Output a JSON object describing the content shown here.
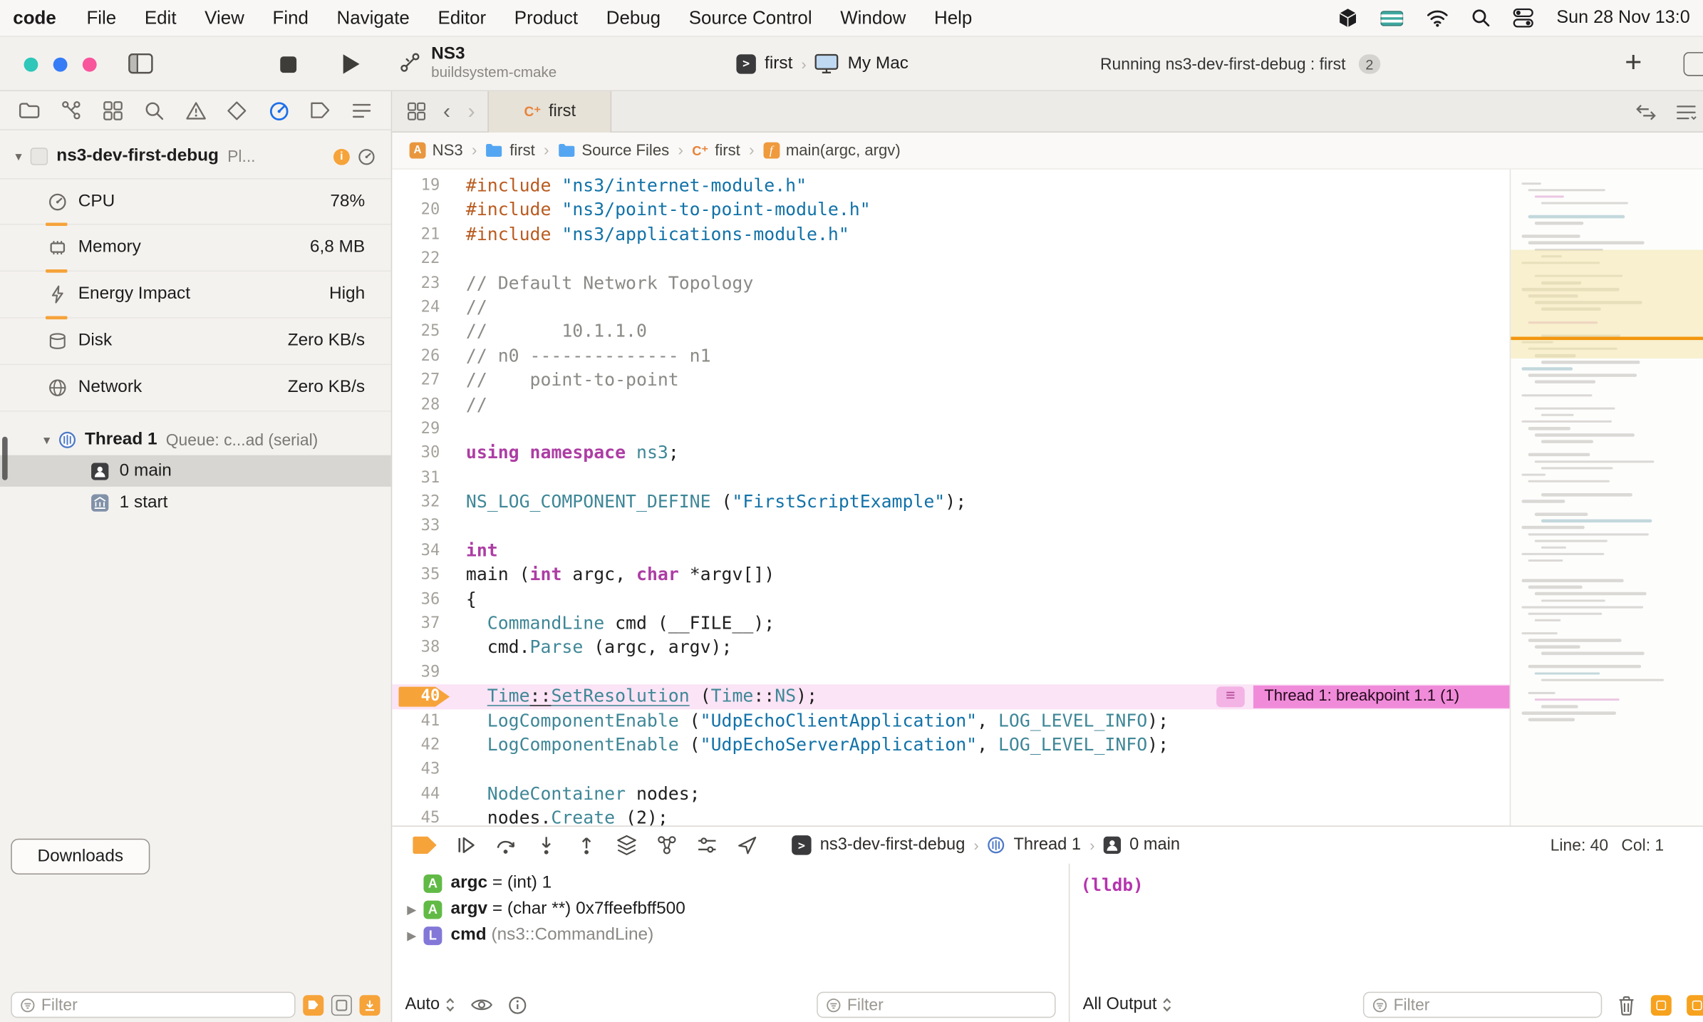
{
  "colors": {
    "accent_orange": "#F6A33A",
    "breakpoint_row_pink": "#FAE4F5",
    "breakpoint_band_pink": "#F08BD9",
    "selected_navigator_blue": "#1D6FE8",
    "traffic_light_1": "#2EC7B9",
    "traffic_light_2": "#357CF6",
    "traffic_light_3": "#F8559D",
    "auto_variable_badge": "#62BA46",
    "local_variable_badge": "#8378D8",
    "lldb_prompt": "#B535AE",
    "syntax_preprocessor": "#BA5B20",
    "syntax_string": "#1272A8",
    "syntax_keyword": "#AD3DA4",
    "syntax_type": "#3F8797",
    "syntax_comment": "#8A8A86"
  },
  "menubar": {
    "app_name": "code",
    "items": [
      "File",
      "Edit",
      "View",
      "Find",
      "Navigate",
      "Editor",
      "Product",
      "Debug",
      "Source Control",
      "Window",
      "Help"
    ],
    "clock": "Sun 28 Nov 13:0"
  },
  "toolbar": {
    "scheme_name": "NS3",
    "scheme_subtitle": "buildsystem-cmake",
    "destination_scheme": "first",
    "destination_device": "My Mac",
    "status_text": "Running ns3-dev-first-debug : first",
    "status_badge": "2"
  },
  "sidebar": {
    "process_name": "ns3-dev-first-debug",
    "process_suffix": "Pl...",
    "stats": [
      {
        "label": "CPU",
        "value": "78%",
        "icon": "cpu-gauge-icon",
        "gauge": true
      },
      {
        "label": "Memory",
        "value": "6,8 MB",
        "icon": "memory-icon",
        "gauge": true
      },
      {
        "label": "Energy Impact",
        "value": "High",
        "icon": "energy-icon",
        "gauge": true
      },
      {
        "label": "Disk",
        "value": "Zero KB/s",
        "icon": "disk-icon",
        "gauge": false
      },
      {
        "label": "Network",
        "value": "Zero KB/s",
        "icon": "network-icon",
        "gauge": false
      }
    ],
    "thread_name": "Thread 1",
    "thread_detail": "Queue: c...ad (serial)",
    "frames": [
      {
        "label": "0 main",
        "icon": "person-icon",
        "selected": true
      },
      {
        "label": "1 start",
        "icon": "library-icon",
        "selected": false
      }
    ],
    "downloads_label": "Downloads",
    "filter_placeholder": "Filter"
  },
  "tabbar": {
    "active_tab": "first",
    "file_badge": "C⁺"
  },
  "breadcrumbs": [
    {
      "label": "NS3",
      "icon": "project-icon"
    },
    {
      "label": "first",
      "icon": "folder-icon"
    },
    {
      "label": "Source Files",
      "icon": "folder-icon"
    },
    {
      "label": "first",
      "icon": "cpp-file-icon"
    },
    {
      "label": "main(argc, argv)",
      "icon": "function-icon"
    }
  ],
  "editor": {
    "breakpoint_line": 40,
    "breakpoint_band_label": "Thread 1: breakpoint 1.1 (1)",
    "lines": [
      {
        "n": 19,
        "t": [
          [
            "pp",
            "#include"
          ],
          [
            "pl",
            " "
          ],
          [
            "str",
            "\"ns3/internet-module.h\""
          ]
        ]
      },
      {
        "n": 20,
        "t": [
          [
            "pp",
            "#include"
          ],
          [
            "pl",
            " "
          ],
          [
            "str",
            "\"ns3/point-to-point-module.h\""
          ]
        ]
      },
      {
        "n": 21,
        "t": [
          [
            "pp",
            "#include"
          ],
          [
            "pl",
            " "
          ],
          [
            "str",
            "\"ns3/applications-module.h\""
          ]
        ]
      },
      {
        "n": 22,
        "t": []
      },
      {
        "n": 23,
        "t": [
          [
            "com",
            "// Default Network Topology"
          ]
        ]
      },
      {
        "n": 24,
        "t": [
          [
            "com",
            "//"
          ]
        ]
      },
      {
        "n": 25,
        "t": [
          [
            "com",
            "//       10.1.1.0"
          ]
        ]
      },
      {
        "n": 26,
        "t": [
          [
            "com",
            "// n0 -------------- n1"
          ]
        ]
      },
      {
        "n": 27,
        "t": [
          [
            "com",
            "//    point-to-point"
          ]
        ]
      },
      {
        "n": 28,
        "t": [
          [
            "com",
            "//"
          ]
        ]
      },
      {
        "n": 29,
        "t": []
      },
      {
        "n": 30,
        "t": [
          [
            "kw",
            "using"
          ],
          [
            "pl",
            " "
          ],
          [
            "kw",
            "namespace"
          ],
          [
            "pl",
            " "
          ],
          [
            "ty",
            "ns3"
          ],
          [
            "pl",
            ";"
          ]
        ]
      },
      {
        "n": 31,
        "t": []
      },
      {
        "n": 32,
        "t": [
          [
            "ty",
            "NS_LOG_COMPONENT_DEFINE"
          ],
          [
            "pl",
            " ("
          ],
          [
            "str",
            "\"FirstScriptExample\""
          ],
          [
            "pl",
            ");"
          ]
        ]
      },
      {
        "n": 33,
        "t": []
      },
      {
        "n": 34,
        "t": [
          [
            "kw",
            "int"
          ]
        ]
      },
      {
        "n": 35,
        "t": [
          [
            "pl",
            "main ("
          ],
          [
            "kw",
            "int"
          ],
          [
            "pl",
            " argc, "
          ],
          [
            "kw",
            "char"
          ],
          [
            "pl",
            " *argv[])"
          ]
        ]
      },
      {
        "n": 36,
        "t": [
          [
            "pl",
            "{"
          ]
        ]
      },
      {
        "n": 37,
        "t": [
          [
            "pl",
            "  "
          ],
          [
            "ty",
            "CommandLine"
          ],
          [
            "pl",
            " cmd (__FILE__);"
          ]
        ]
      },
      {
        "n": 38,
        "t": [
          [
            "pl",
            "  cmd."
          ],
          [
            "ty",
            "Parse"
          ],
          [
            "pl",
            " (argc, argv);"
          ]
        ]
      },
      {
        "n": 39,
        "t": []
      },
      {
        "n": 40,
        "t": [
          [
            "pl",
            "  "
          ],
          [
            "ty u",
            "Time"
          ],
          [
            "pl u",
            "::"
          ],
          [
            "ty u",
            "SetResolution"
          ],
          [
            "pl",
            " ("
          ],
          [
            "ty",
            "Time"
          ],
          [
            "pl",
            "::"
          ],
          [
            "ty",
            "NS"
          ],
          [
            "pl",
            ");"
          ]
        ]
      },
      {
        "n": 41,
        "t": [
          [
            "pl",
            "  "
          ],
          [
            "ty",
            "LogComponentEnable"
          ],
          [
            "pl",
            " ("
          ],
          [
            "str",
            "\"UdpEchoClientApplication\""
          ],
          [
            "pl",
            ", "
          ],
          [
            "ty",
            "LOG_LEVEL_INFO"
          ],
          [
            "pl",
            ");"
          ]
        ]
      },
      {
        "n": 42,
        "t": [
          [
            "pl",
            "  "
          ],
          [
            "ty",
            "LogComponentEnable"
          ],
          [
            "pl",
            " ("
          ],
          [
            "str",
            "\"UdpEchoServerApplication\""
          ],
          [
            "pl",
            ", "
          ],
          [
            "ty",
            "LOG_LEVEL_INFO"
          ],
          [
            "pl",
            ");"
          ]
        ]
      },
      {
        "n": 43,
        "t": []
      },
      {
        "n": 44,
        "t": [
          [
            "pl",
            "  "
          ],
          [
            "ty",
            "NodeContainer"
          ],
          [
            "pl",
            " nodes;"
          ]
        ]
      },
      {
        "n": 45,
        "t": [
          [
            "pl",
            "  nodes."
          ],
          [
            "ty",
            "Create"
          ],
          [
            "pl",
            " (2);"
          ]
        ]
      }
    ]
  },
  "debug_bar": {
    "process": "ns3-dev-first-debug",
    "thread": "Thread 1",
    "frame": "0 main",
    "line_label": "Line: 40",
    "col_label": "Col: 1"
  },
  "variables": [
    {
      "badge": "A",
      "kind": "auto",
      "name": "argc",
      "value": " = (int) 1",
      "expandable": false,
      "muted": false
    },
    {
      "badge": "A",
      "kind": "auto",
      "name": "argv",
      "value": " = (char **) 0x7ffeefbff500",
      "expandable": true,
      "muted": false
    },
    {
      "badge": "L",
      "kind": "local",
      "name": "cmd",
      "value": " (ns3::CommandLine)",
      "expandable": true,
      "muted": true
    }
  ],
  "console": {
    "prompt": "(lldb)"
  },
  "debug_footer": {
    "scope_label": "Auto",
    "variables_filter_placeholder": "Filter",
    "output_label": "All Output",
    "console_filter_placeholder": "Filter"
  }
}
